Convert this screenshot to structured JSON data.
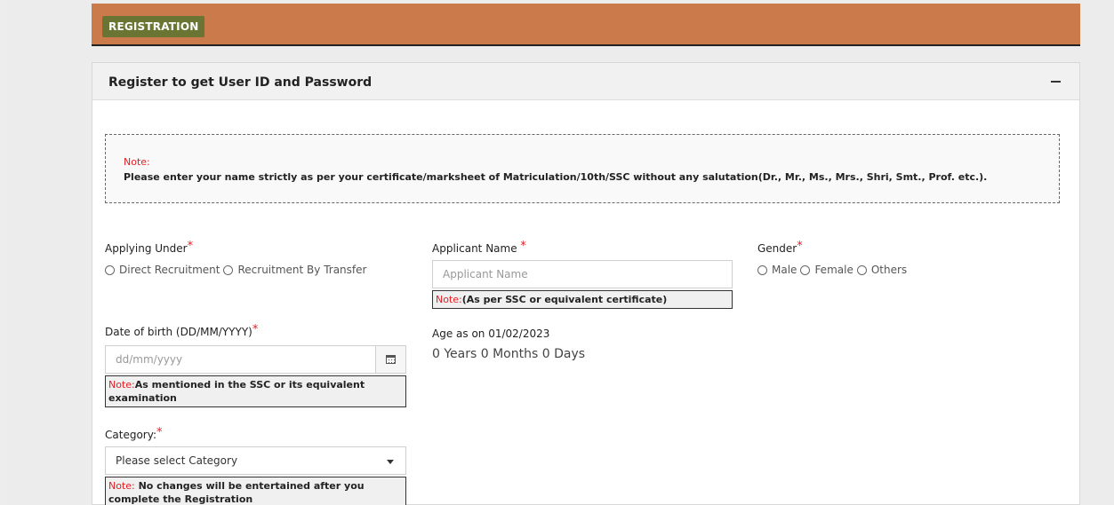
{
  "header": {
    "badge": "REGISTRATION"
  },
  "panel": {
    "title": "Register to get User ID and Password"
  },
  "note": {
    "label": "Note:",
    "text": "Please enter your name strictly as per your certificate/marksheet of Matriculation/10th/SSC without any salutation(Dr., Mr., Ms., Mrs., Shri, Smt., Prof. etc.)."
  },
  "form": {
    "applying_under": {
      "label": "Applying Under",
      "options": [
        "Direct Recruitment",
        "Recruitment By Transfer"
      ]
    },
    "applicant_name": {
      "label": "Applicant Name ",
      "placeholder": "Applicant Name",
      "hint_red": "Note:",
      "hint_text": "(As per SSC or equivalent certificate)"
    },
    "gender": {
      "label": "Gender",
      "options": [
        "Male",
        "Female",
        "Others"
      ]
    },
    "dob": {
      "label": "Date of birth (DD/MM/YYYY)",
      "placeholder": "dd/mm/yyyy",
      "hint_red": "Note:",
      "hint_text": "As mentioned in the SSC or its equivalent examination"
    },
    "age": {
      "label": "Age as on 01/02/2023",
      "value": "0 Years 0 Months 0 Days"
    },
    "category": {
      "label": "Category:",
      "selected": "Please select Category",
      "hint_red": "Note:",
      "hint_text": " No changes will be entertained after you complete the Registration"
    }
  },
  "required_mark": "*"
}
